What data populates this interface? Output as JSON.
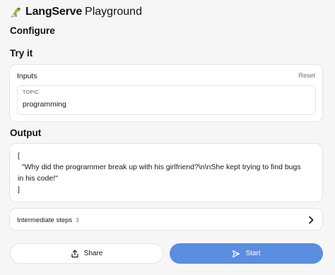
{
  "header": {
    "brand_bold": "LangServe",
    "brand_light": "Playground"
  },
  "sections": {
    "configure": "Configure",
    "try_it": "Try it",
    "output": "Output"
  },
  "inputs": {
    "title": "Inputs",
    "reset_label": "Reset",
    "topic_label": "TOPIC",
    "topic_value": "programming"
  },
  "output": {
    "text": "[\n  \"Why did the programmer break up with his girlfriend?\\n\\nShe kept trying to find bugs\nin his code!\"\n]"
  },
  "steps": {
    "label": "Intermediate steps",
    "count": "3"
  },
  "actions": {
    "share_label": "Share",
    "start_label": "Start"
  },
  "colors": {
    "accent": "#5b8de0",
    "background": "#f6f6f7"
  },
  "icons": {
    "logo": "parrot-icon",
    "share": "share-icon",
    "start": "send-icon",
    "steps": "chevron-right-icon"
  }
}
